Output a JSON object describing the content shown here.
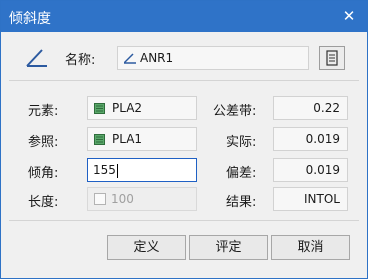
{
  "window": {
    "title": "倾斜度",
    "close_glyph": "✕"
  },
  "name_row": {
    "label": "名称:",
    "value": "ANR1"
  },
  "labels": {
    "element": "元素:",
    "reference": "参照:",
    "angle": "倾角:",
    "length": "长度:",
    "tolerance": "公差带:",
    "actual": "实际:",
    "deviation": "偏差:",
    "result": "结果:"
  },
  "fields": {
    "element": "PLA2",
    "reference": "PLA1",
    "angle": "155",
    "length": "100",
    "tolerance": "0.22",
    "actual": "0.019",
    "deviation": "0.019",
    "result": "INTOL"
  },
  "buttons": {
    "define": "定义",
    "evaluate": "评定",
    "cancel": "取消"
  },
  "colors": {
    "titlebar": "#2f73c8",
    "focus_border": "#1f60c4",
    "plane_icon": "#3a8a4a"
  },
  "icons": [
    "angularity-icon",
    "close-icon",
    "plane-feature-icon",
    "calculator-icon",
    "checkbox"
  ]
}
